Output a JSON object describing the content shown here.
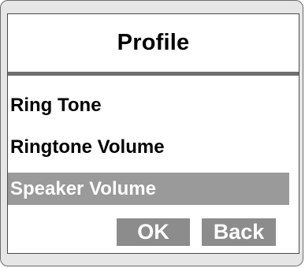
{
  "header": {
    "title": "Profile"
  },
  "menu": {
    "items": [
      {
        "label": "Ring Tone",
        "selected": false
      },
      {
        "label": "Ringtone Volume",
        "selected": false
      },
      {
        "label": "Speaker Volume",
        "selected": true
      }
    ]
  },
  "buttons": {
    "ok_label": "OK",
    "back_label": "Back"
  },
  "colors": {
    "selection": "#9a9a9a",
    "button": "#8c8c8c",
    "device_frame": "#e6e6e6",
    "title_rule": "#6f6f6f"
  }
}
